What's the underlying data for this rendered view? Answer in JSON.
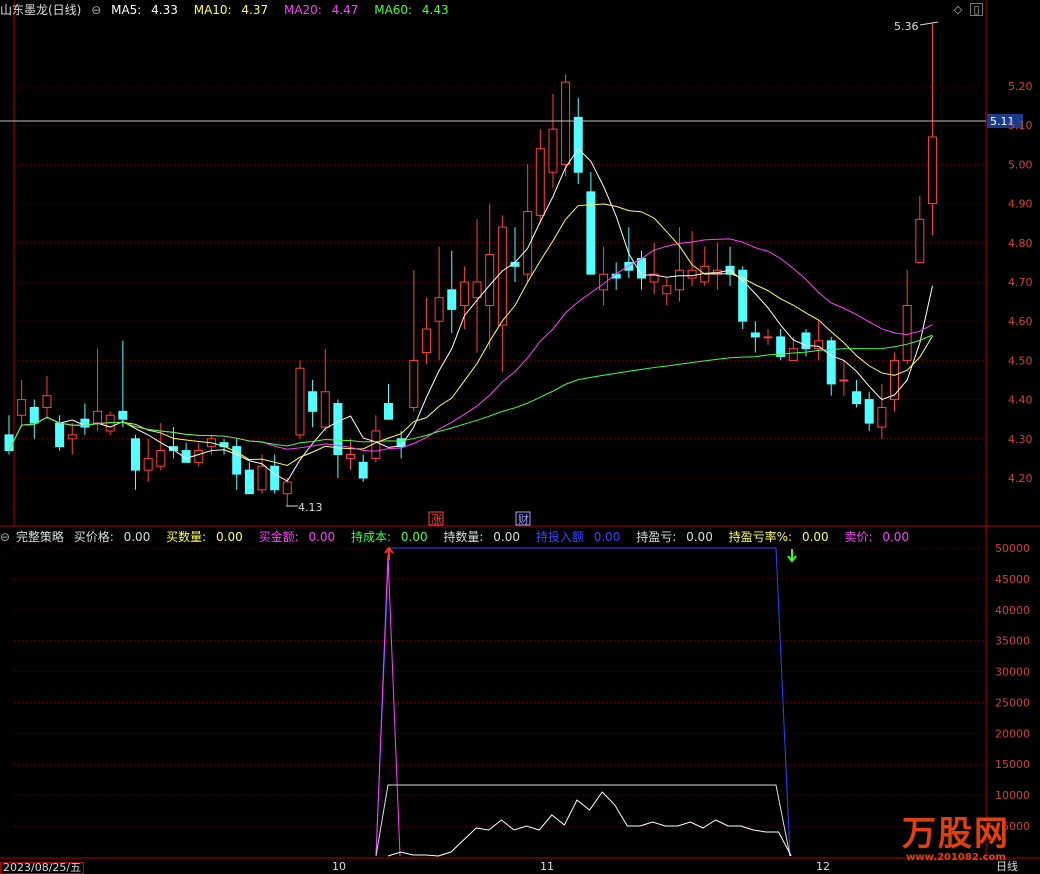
{
  "main_panel": {
    "title": "山东墨龙(日线)",
    "ma": [
      {
        "label": "MA5:",
        "value": "4.33",
        "color": "#ffffff"
      },
      {
        "label": "MA10:",
        "value": "4.37",
        "color": "#ffff50"
      },
      {
        "label": "MA20:",
        "value": "4.47",
        "color": "#ff40ff"
      },
      {
        "label": "MA60:",
        "value": "4.43",
        "color": "#40ff40"
      }
    ],
    "y_ticks": [
      "5.20",
      "5.10",
      "5.00",
      "4.90",
      "4.80",
      "4.70",
      "4.60",
      "4.50",
      "4.40",
      "4.30",
      "4.20"
    ],
    "crosshair_price": "5.11",
    "high_annotation": "5.36",
    "low_annotation": "4.13",
    "event_markers": [
      {
        "label": "涨",
        "color": "#ff4040"
      },
      {
        "label": "财",
        "color": "#a0a0ff"
      }
    ]
  },
  "sub_panel": {
    "title": "完整策略",
    "fields": [
      {
        "label": "买价格:",
        "value": "0.00",
        "color": "#dddddd"
      },
      {
        "label": "买数量:",
        "value": "0.00",
        "color": "#ffff50"
      },
      {
        "label": "买金额:",
        "value": "0.00",
        "color": "#ff40ff"
      },
      {
        "label": "持成本:",
        "value": "0.00",
        "color": "#40ff40"
      },
      {
        "label": "持数量:",
        "value": "0.00",
        "color": "#dddddd"
      },
      {
        "label": "持投入额",
        "value": "0.00",
        "color": "#4040ff"
      },
      {
        "label": "持盈亏:",
        "value": "0.00",
        "color": "#dddddd"
      },
      {
        "label": "持盈亏率%:",
        "value": "0.00",
        "color": "#ffff50"
      },
      {
        "label": "卖价:",
        "value": "0.00",
        "color": "#ff40ff"
      }
    ],
    "y_ticks": [
      "50000",
      "45000",
      "40000",
      "35000",
      "30000",
      "25000",
      "20000",
      "15000",
      "10000",
      "5000"
    ]
  },
  "bottom_bar": {
    "date": "2023/08/25/五",
    "month_labels": [
      "10",
      "11",
      "12"
    ],
    "period": "日线"
  },
  "watermark": {
    "brand": "万股网",
    "url": "www.201082.com"
  },
  "colors": {
    "up": "#ff4040",
    "down": "#54ffff",
    "grid": "#800000",
    "frame": "#b00000"
  }
}
